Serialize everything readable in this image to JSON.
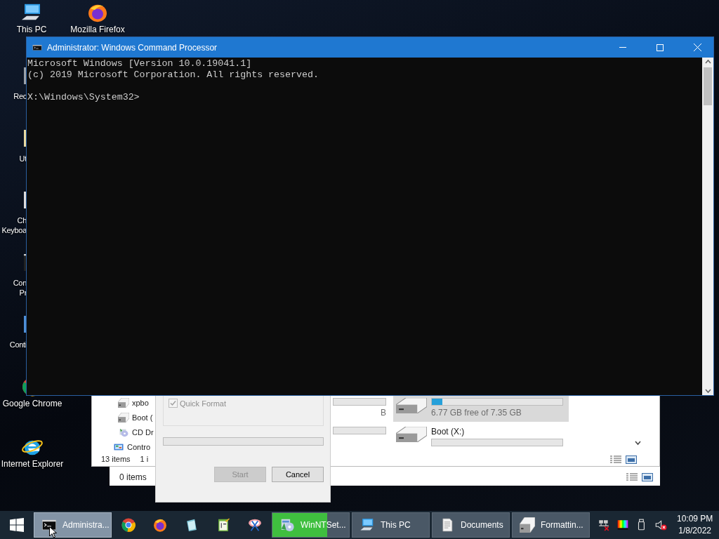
{
  "desktop_icons": [
    {
      "kind": "pc",
      "lines": [
        "This PC"
      ]
    },
    {
      "kind": "firefox",
      "lines": [
        "Mozilla Firefox"
      ]
    },
    {
      "kind": "bin",
      "lines": [
        "Rec"
      ]
    },
    {
      "kind": "folder",
      "lines": [
        "Ut"
      ]
    },
    {
      "kind": "keyboard",
      "lines": [
        "Ch",
        "Keyboa"
      ]
    },
    {
      "kind": "cmd",
      "lines": [
        "Con",
        "Pr"
      ]
    },
    {
      "kind": "control",
      "lines": [
        "Conti"
      ]
    },
    {
      "kind": "chrome",
      "lines": [
        "Google Chrome"
      ]
    },
    {
      "kind": "ie",
      "lines": [
        "Internet Explorer"
      ]
    }
  ],
  "explorer_back": {
    "status": "0 items"
  },
  "explorer_front": {
    "nav_items": [
      {
        "kind": "drive",
        "label": "xpbo"
      },
      {
        "kind": "drive",
        "label": "Boot ("
      },
      {
        "kind": "cd",
        "label": "CD Dr"
      },
      {
        "kind": "control",
        "label": "Contro"
      }
    ],
    "status": "13 items",
    "selection": "1 i",
    "drives_left": [
      {
        "free": "B",
        "level": 0,
        "selected": false
      },
      {
        "level": 0,
        "selected": false
      }
    ],
    "drives_right": [
      {
        "free": "6.77 GB free of 7.35 GB",
        "level": 0.08,
        "selected": true
      },
      {
        "name": "Boot (X:)",
        "level": 0,
        "selected": false
      }
    ]
  },
  "format_dialog": {
    "quick_format": {
      "label": "Quick Format",
      "checked": true,
      "disabled": true
    },
    "progress": {
      "level": 0
    },
    "buttons": [
      {
        "label": "Start",
        "disabled": true
      },
      {
        "label": "Cancel",
        "disabled": false
      }
    ]
  },
  "cmd_window": {
    "title": "Administrator: Windows Command Processor",
    "output": [
      "Microsoft Windows [Version 10.0.19041.1]",
      "(c) 2019 Microsoft Corporation. All rights reserved."
    ],
    "prompt": "X:\\Windows\\System32>"
  },
  "taskbar": {
    "buttons": [
      {
        "kind": "cmd",
        "label": "Administra...",
        "selected": true
      },
      {
        "kind": "chrome",
        "selected": false
      },
      {
        "kind": "firefox",
        "selected": false
      },
      {
        "kind": "notepad",
        "selected": false
      },
      {
        "kind": "editor",
        "selected": false
      },
      {
        "kind": "paint",
        "selected": false
      },
      {
        "kind": "setup",
        "label": "WinNTSet...",
        "selected": false,
        "level": 0.72
      },
      {
        "kind": "pc",
        "label": "This PC",
        "selected": false
      },
      {
        "kind": "document",
        "label": "Documents",
        "selected": false
      },
      {
        "kind": "drive",
        "label": "Formattin...",
        "selected": false
      }
    ],
    "tray": [
      {
        "kind": "network"
      },
      {
        "kind": "color"
      },
      {
        "kind": "usb"
      },
      {
        "kind": "volume"
      }
    ],
    "clock": {
      "time": "10:09 PM",
      "date": "1/8/2022"
    }
  }
}
